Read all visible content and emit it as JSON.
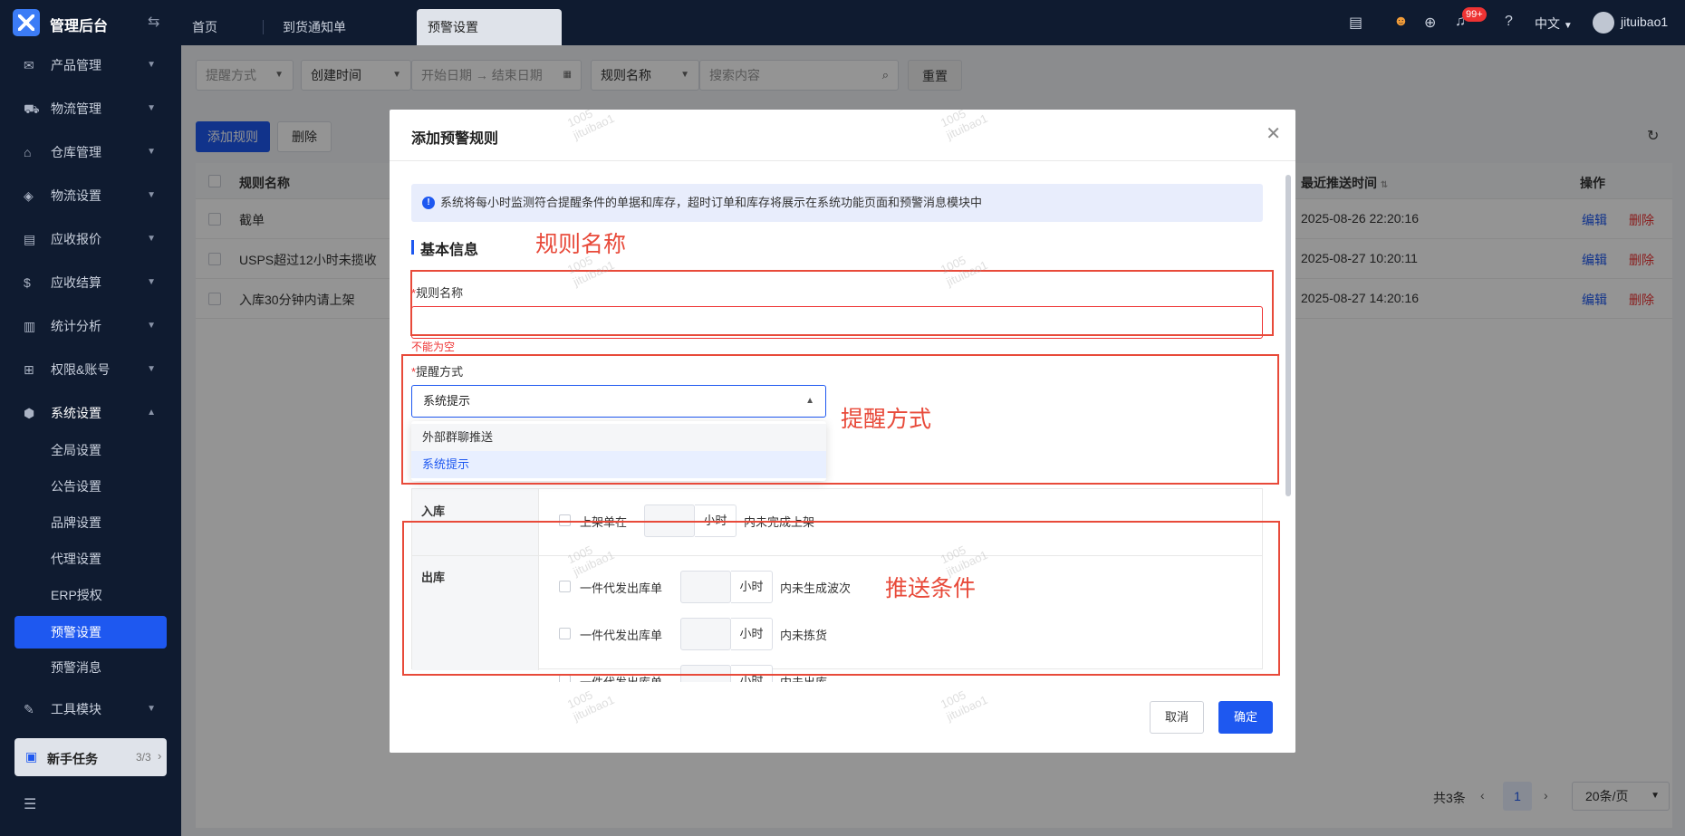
{
  "app": {
    "title": "管理后台"
  },
  "tabs": [
    {
      "label": "首页"
    },
    {
      "label": "到货通知单"
    },
    {
      "label": "预警设置"
    }
  ],
  "header": {
    "notification_badge": "99+",
    "language": "中文",
    "username": "jituibao1"
  },
  "sidebar": {
    "items": [
      {
        "label": "产品管理"
      },
      {
        "label": "物流管理"
      },
      {
        "label": "仓库管理"
      },
      {
        "label": "物流设置"
      },
      {
        "label": "应收报价"
      },
      {
        "label": "应收结算"
      },
      {
        "label": "统计分析"
      },
      {
        "label": "权限&账号"
      },
      {
        "label": "系统设置"
      }
    ],
    "sub_items": [
      {
        "label": "全局设置"
      },
      {
        "label": "公告设置"
      },
      {
        "label": "品牌设置"
      },
      {
        "label": "代理设置"
      },
      {
        "label": "ERP授权"
      },
      {
        "label": "预警设置"
      },
      {
        "label": "预警消息"
      }
    ],
    "tools": {
      "label": "工具模块"
    },
    "newbie": {
      "label": "新手任务",
      "count": "3/3"
    }
  },
  "filters": {
    "remind_method_placeholder": "提醒方式",
    "date_type": "创建时间",
    "start_date_placeholder": "开始日期",
    "end_date_placeholder": "结束日期",
    "search_field": "规则名称",
    "search_placeholder": "搜索内容",
    "reset_label": "重置"
  },
  "toolbar": {
    "add_label": "添加规则",
    "delete_label": "删除"
  },
  "table": {
    "headers": {
      "name": "规则名称",
      "last_push": "最近推送时间",
      "actions": "操作"
    },
    "rows": [
      {
        "name": "截单",
        "last_push": "2025-08-26 22:20:16",
        "edit": "编辑",
        "delete": "删除"
      },
      {
        "name": "USPS超过12小时未揽收",
        "last_push": "2025-08-27 10:20:11",
        "edit": "编辑",
        "delete": "删除"
      },
      {
        "name": "入库30分钟内请上架",
        "last_push": "2025-08-27 14:20:16",
        "edit": "编辑",
        "delete": "删除"
      }
    ]
  },
  "pagination": {
    "total": "共3条",
    "current": "1",
    "page_size": "20条/页"
  },
  "modal": {
    "title": "添加预警规则",
    "info": "系统将每小时监测符合提醒条件的单据和库存，超时订单和库存将展示在系统功能页面和预警消息模块中",
    "section_title": "基本信息",
    "rule_name_label": "规则名称",
    "required_mark": "*",
    "rule_name_error": "不能为空",
    "remind_method_label": "提醒方式",
    "remind_method_value": "系统提示",
    "remind_options": [
      {
        "label": "外部群聊推送"
      },
      {
        "label": "系统提示"
      }
    ],
    "conditions": {
      "inbound_label": "入库",
      "outbound_label": "出库",
      "unit": "小时",
      "inbound": [
        {
          "prefix": "上架单在",
          "suffix": "内未完成上架"
        }
      ],
      "outbound": [
        {
          "prefix": "一件代发出库单",
          "suffix": "内未生成波次"
        },
        {
          "prefix": "一件代发出库单",
          "suffix": "内未拣货"
        },
        {
          "prefix": "一件代发出库单",
          "suffix": "内未出库"
        }
      ]
    },
    "cancel_label": "取消",
    "ok_label": "确定"
  },
  "annotations": {
    "rule_name": "规则名称",
    "remind_method": "提醒方式",
    "push_conditions": "推送条件"
  },
  "watermark": {
    "line1": "1005",
    "line2": "jituibao1"
  },
  "colors": {
    "primary": "#1e58f0",
    "sidebar_bg": "#0f1b30",
    "annotation": "#e84a3a",
    "error": "#e33333"
  }
}
